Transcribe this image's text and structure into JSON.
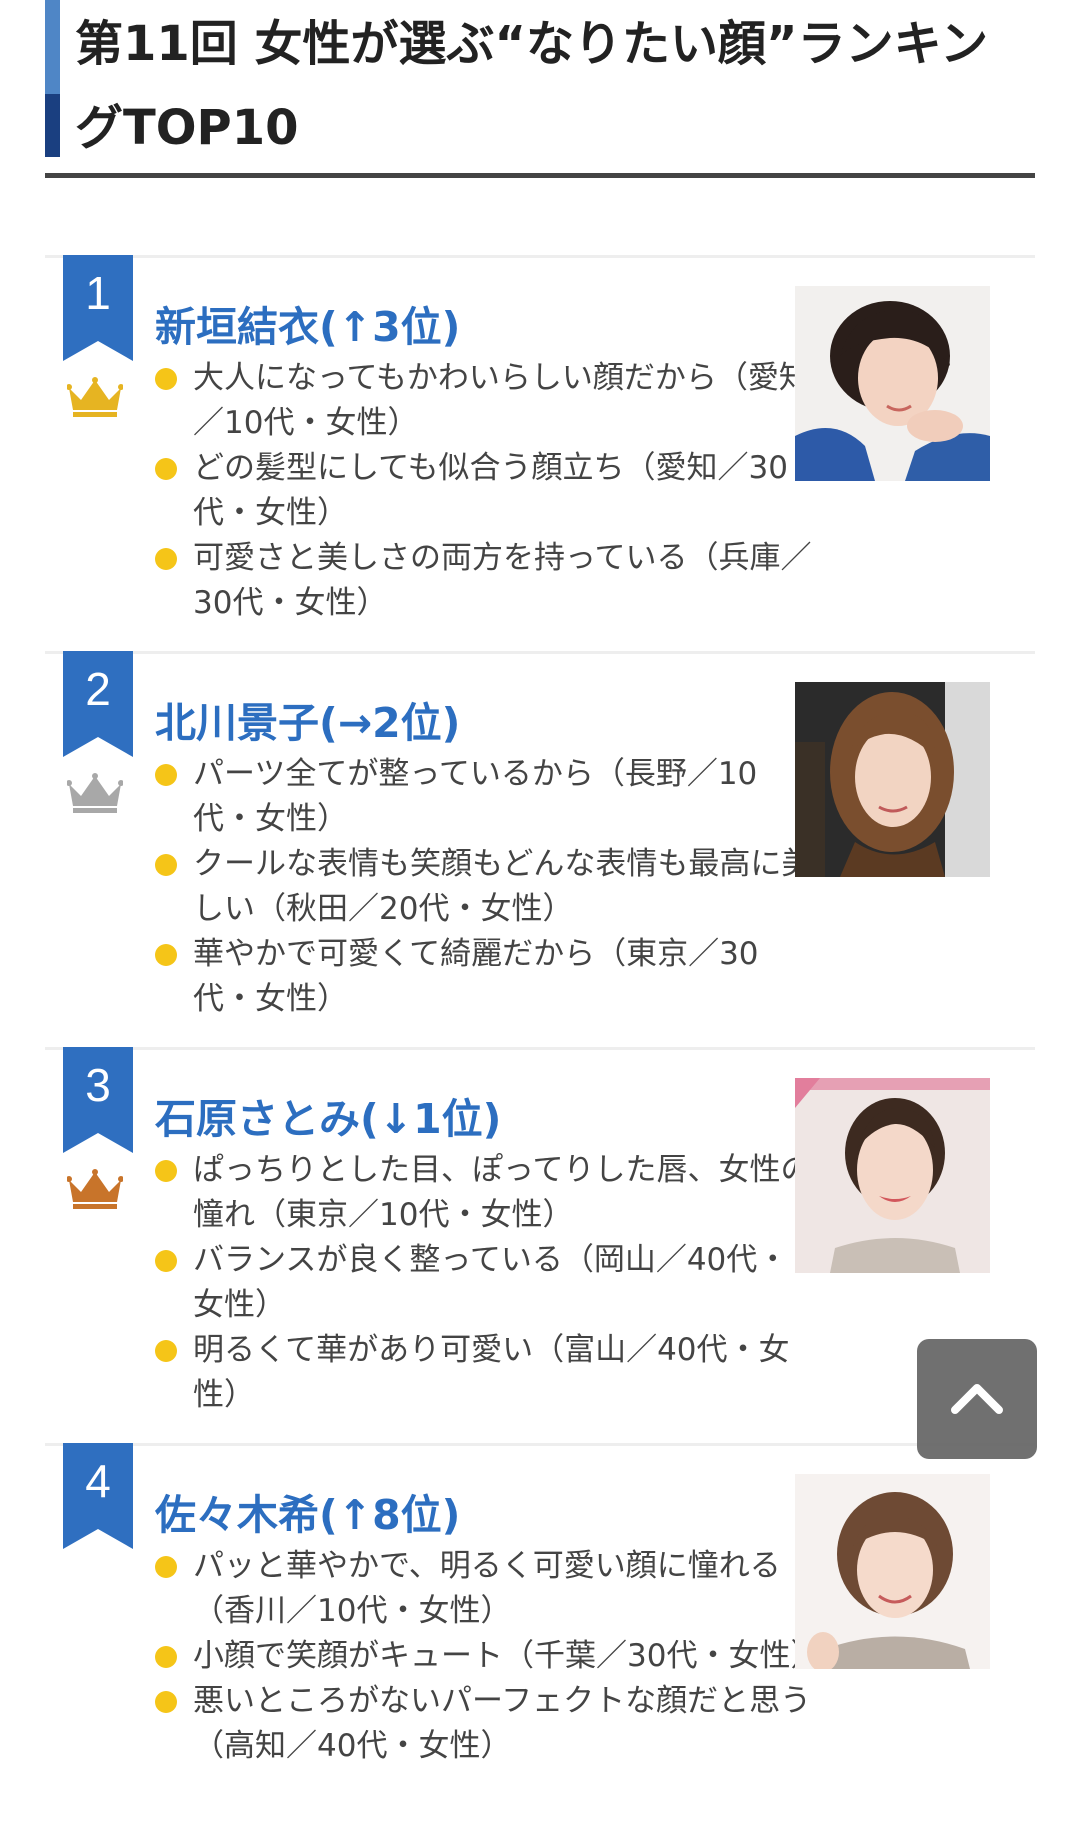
{
  "page": {
    "title": "第11回 女性が選ぶ“なりたい顔”ランキングTOP10"
  },
  "colors": {
    "accent_blue": "#2c6ec0",
    "badge_blue": "#2f6fc0",
    "bullet_yellow": "#f5c518",
    "crown_gold": "#e6b422",
    "crown_silver": "#a8a8a8",
    "crown_bronze": "#c8742a"
  },
  "rankings": [
    {
      "rank": "1",
      "name": "新垣結衣(↑3位)",
      "crown": "gold-crown-icon",
      "crown_color": "#e6b422",
      "photo": "portrait-photo",
      "comments": [
        "大人になってもかわいらしい顔だから（愛知／10代・女性）",
        "どの髪型にしても似合う顔立ち（愛知／30代・女性）",
        "可愛さと美しさの両方を持っている（兵庫／30代・女性）"
      ]
    },
    {
      "rank": "2",
      "name": "北川景子(→2位)",
      "crown": "silver-crown-icon",
      "crown_color": "#a8a8a8",
      "photo": "portrait-photo",
      "comments": [
        "パーツ全てが整っているから（長野／10代・女性）",
        "クールな表情も笑顔もどんな表情も最高に美しい（秋田／20代・女性）",
        "華やかで可愛くて綺麗だから（東京／30代・女性）"
      ]
    },
    {
      "rank": "3",
      "name": "石原さとみ(↓1位)",
      "crown": "bronze-crown-icon",
      "crown_color": "#c8742a",
      "photo": "portrait-photo",
      "comments": [
        "ぱっちりとした目、ぽってりした唇、女性の憧れ（東京／10代・女性）",
        "バランスが良く整っている（岡山／40代・女性）",
        "明るくて華があり可愛い（富山／40代・女性）"
      ]
    },
    {
      "rank": "4",
      "name": "佐々木希(↑8位)",
      "crown": "",
      "crown_color": "",
      "photo": "portrait-photo",
      "comments": [
        "パッと華やかで、明るく可愛い顔に憧れる（香川／10代・女性）",
        "小顔で笑顔がキュート（千葉／30代・女性）",
        "悪いところがないパーフェクトな顔だと思う（高知／40代・女性）"
      ]
    }
  ],
  "back_to_top": {
    "icon": "chevron-up-icon"
  }
}
